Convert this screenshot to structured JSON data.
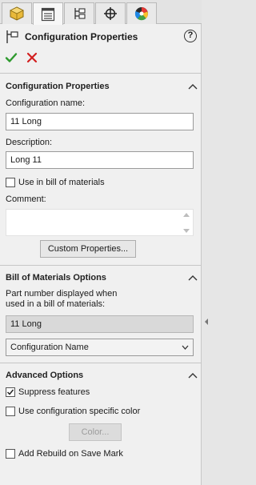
{
  "tabs": [
    {
      "icon": "feature-manager-icon"
    },
    {
      "icon": "property-manager-icon"
    },
    {
      "icon": "configuration-manager-icon"
    },
    {
      "icon": "dimxpert-manager-icon"
    },
    {
      "icon": "display-manager-icon"
    }
  ],
  "header": {
    "title": "Configuration Properties",
    "help": "?"
  },
  "config_section": {
    "title": "Configuration Properties",
    "name_label": "Configuration name:",
    "name_value": "11 Long",
    "description_label": "Description:",
    "description_value": "Long 11",
    "use_in_bom_label": "Use in bill of materials",
    "use_in_bom_checked": false,
    "comment_label": "Comment:",
    "comment_value": "",
    "custom_properties_button": "Custom Properties..."
  },
  "bom_section": {
    "title": "Bill of Materials Options",
    "part_number_label_line1": "Part number displayed when",
    "part_number_label_line2": "used in a bill of materials:",
    "part_number_value": "11 Long",
    "source_selected": "Configuration Name"
  },
  "advanced_section": {
    "title": "Advanced Options",
    "suppress_features_label": "Suppress features",
    "suppress_features_checked": true,
    "specific_color_label": "Use configuration specific color",
    "specific_color_checked": false,
    "color_button": "Color...",
    "rebuild_mark_label": "Add Rebuild on Save Mark",
    "rebuild_mark_checked": false
  },
  "colors": {
    "ok_green": "#2e9a2e",
    "cancel_red": "#d21f1f"
  }
}
